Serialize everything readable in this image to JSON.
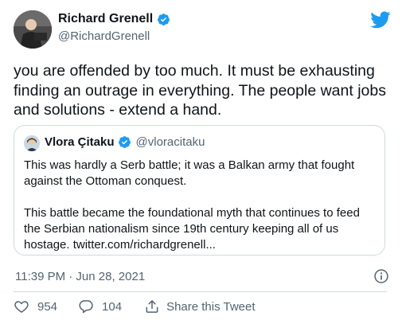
{
  "tweet": {
    "author_name": "Richard Grenell",
    "author_handle": "@RichardGrenell",
    "text": "you are offended by too much. It must be exhausting finding an outrage in everything. The people want jobs and solutions - extend a hand.",
    "timestamp": "11:39 PM · Jun 28, 2021",
    "likes": "954",
    "replies": "104",
    "share_label": "Share this Tweet",
    "accent_color": "#1d9bf0"
  },
  "quoted": {
    "author_name": "Vlora Çitaku",
    "author_handle": "@vloracitaku",
    "paragraph_1": "This was hardly a Serb battle; it was a Balkan army that fought against the Ottoman conquest.",
    "paragraph_2": "This battle became the foundational myth that continues to feed the Serbian nationalism since 19th century keeping all of us hostage. twitter.com/richardgrenell..."
  },
  "icons": {
    "brand": "twitter-bird-icon",
    "verified": "verified-badge-icon",
    "info": "info-icon",
    "like": "heart-icon",
    "reply": "speech-bubble-icon",
    "share": "share-upload-icon"
  }
}
